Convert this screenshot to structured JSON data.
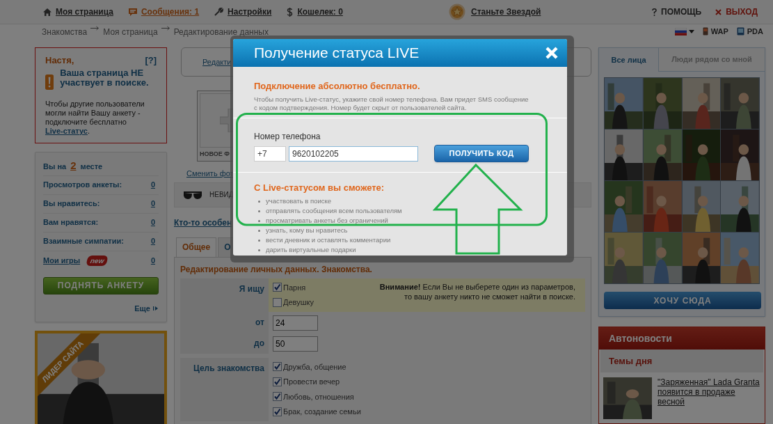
{
  "top_nav": {
    "items": [
      {
        "label": "Моя страница",
        "kind": "home",
        "highlighted": false
      },
      {
        "label": "Сообщения: 1",
        "kind": "messages",
        "highlighted": true
      },
      {
        "label": "Настройки",
        "kind": "settings",
        "highlighted": false
      },
      {
        "label": "Кошелек: 0",
        "kind": "wallet",
        "highlighted": false
      }
    ],
    "star_link": "Станьте Звездой",
    "help": "ПОМОЩЬ",
    "logout": "ВЫХОД"
  },
  "breadcrumb": [
    "Знакомства",
    "Моя страница",
    "Редактирование данных"
  ],
  "versions": [
    {
      "label": "WAP",
      "kind": "phone"
    },
    {
      "label": "PDA",
      "kind": "pda"
    }
  ],
  "search_alert": {
    "name": "Настя,",
    "help": "[?]",
    "headline": "Ваша страница НЕ участвует в поиске.",
    "text": "Чтобы другие пользователи могли найти Вашу анкету - подключите бесплатно",
    "link": "Live-статус",
    "tail": "."
  },
  "rating": {
    "prefix": "Вы на",
    "place": "2",
    "suffix": "месте"
  },
  "stats": [
    {
      "label": "Просмотров анкеты:",
      "value": "0",
      "is_link": false
    },
    {
      "label": "Вы нравитесь:",
      "value": "0",
      "is_link": false
    },
    {
      "label": "Вам нравятся:",
      "value": "0",
      "is_link": false
    },
    {
      "label": "Взаимные симпатии:",
      "value": "0",
      "is_link": false
    },
    {
      "label": "Мои игры",
      "value": "0",
      "is_link": true,
      "badge": "new"
    }
  ],
  "raise_button": "ПОДНЯТЬ АНКЕТУ",
  "more_link": "Еще",
  "leader": {
    "ribbon": "ЛИДЕР САЙТА"
  },
  "profile_partial": {
    "bubble_link": "Редакти",
    "photo_caption": "НОВОЕ Ф",
    "change_photo": "Сменить фот",
    "invisible": "НЕВИД",
    "special_link": "Кто-то особен"
  },
  "tabs": [
    {
      "label": "Общее",
      "selected": true
    },
    {
      "label": "О",
      "selected": false
    }
  ],
  "form": {
    "heading": "Редактирование личных данных. Знакомства.",
    "rows": [
      {
        "label": "Я ищу",
        "kind": "checks",
        "options": [
          {
            "label": "Парня",
            "checked": true
          },
          {
            "label": "Девушку",
            "checked": false
          }
        ],
        "note": "**Внимание!** Если Вы не выберете один из параметров, то вашу анкету никто не сможет найти в поиске."
      },
      {
        "label": "от",
        "kind": "input",
        "value": "24"
      },
      {
        "label": "до",
        "kind": "input",
        "value": "50"
      },
      {
        "label": "Цель знакомства",
        "kind": "checks",
        "options": [
          {
            "label": "Дружба, общение",
            "checked": true
          },
          {
            "label": "Провести вечер",
            "checked": true
          },
          {
            "label": "Любовь, отношения",
            "checked": true
          },
          {
            "label": "Брак, создание семьи",
            "checked": true
          }
        ]
      }
    ]
  },
  "people": {
    "tabs": [
      {
        "label": "Все лица",
        "selected": true
      },
      {
        "label": "Люди рядом со мной",
        "selected": false
      }
    ]
  },
  "join_button": "ХОЧУ СЮДА",
  "autonews": {
    "title": "Автоновости",
    "subtitle": "Темы дня",
    "items": [
      {
        "link": "\"Заряженная\" Lada Granta появится в продаже весной"
      }
    ]
  },
  "modal": {
    "title": "Получение статуса LIVE",
    "headline": "Подключение абсолютно бесплатно.",
    "intro": "Чтобы получить Live-статус, укажите свой номер телефона. Вам придет SMS сообщение с кодом подтверждения. Номер будет скрыт от пользователей сайта.",
    "phone_label": "Номер телефона",
    "country_code": "+7",
    "phone": "9620102205",
    "submit": "ПОЛУЧИТЬ КОД",
    "features_title": "С Live-статусом вы сможете:",
    "features": [
      "участвовать в поиске",
      "отправлять сообщения всем пользователям",
      "просматривать анкеты без ограничений",
      "узнать, кому вы нравитесь",
      "вести дневник и оставлять комментарии",
      "дарить виртуальные подарки"
    ]
  }
}
